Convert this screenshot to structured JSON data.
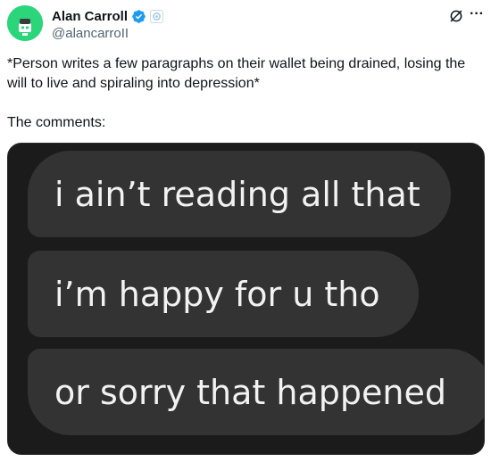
{
  "author": {
    "name": "Alan Carroll",
    "handle": "@alancarroII",
    "avatar_color": "#2bd67b",
    "verified_color": "#1d9bf0"
  },
  "actions": {
    "grok_icon": "grok-icon",
    "more_icon": "more-options-icon",
    "more_label": "···"
  },
  "tweet": {
    "paragraph_1": "*Person writes a few paragraphs on their wallet being drained, losing the will to live and spiraling into depression*",
    "paragraph_2": "The comments:"
  },
  "media": {
    "background": "#1b1b1b",
    "bubble_color": "#333333",
    "bubbles": [
      "i ain’t reading all that",
      "i’m happy for u tho",
      "or sorry that happened"
    ]
  }
}
